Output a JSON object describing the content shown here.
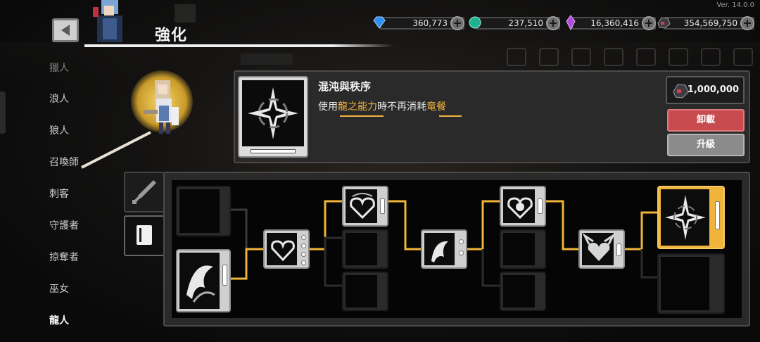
{
  "app": {
    "version": "Ver. 14.0.0"
  },
  "header": {
    "title": "強化"
  },
  "currencies": [
    {
      "name": "sapphire",
      "icon": "blue-gem-icon",
      "value": "360,773",
      "color": "#2f8ef0"
    },
    {
      "name": "emerald",
      "icon": "green-gem-icon",
      "value": "237,510",
      "color": "#2fd8b0"
    },
    {
      "name": "amethyst",
      "icon": "purple-crystal-icon",
      "value": "16,360,416",
      "color": "#b04ad8"
    },
    {
      "name": "ore",
      "icon": "dark-ore-icon",
      "value": "354,569,750",
      "color": "#d04050"
    }
  ],
  "sidebar": {
    "items": [
      {
        "label": "獵人",
        "active": false
      },
      {
        "label": "浪人",
        "active": false
      },
      {
        "label": "狼人",
        "active": false
      },
      {
        "label": "召喚師",
        "active": false
      },
      {
        "label": "刺客",
        "active": false
      },
      {
        "label": "守護者",
        "active": false
      },
      {
        "label": "掠奪者",
        "active": false
      },
      {
        "label": "巫女",
        "active": false
      },
      {
        "label": "龍人",
        "active": true
      }
    ]
  },
  "skill": {
    "name": "混沌與秩序",
    "desc_prefix": "使用",
    "desc_hl1": "龍之能力",
    "desc_mid": "時不再消耗",
    "desc_hl2": "竜餐",
    "cost": "1,000,000",
    "unequip_label": "卸載",
    "upgrade_label": "升級"
  },
  "colors": {
    "accent": "#f3b33d",
    "danger": "#c84b4f"
  }
}
